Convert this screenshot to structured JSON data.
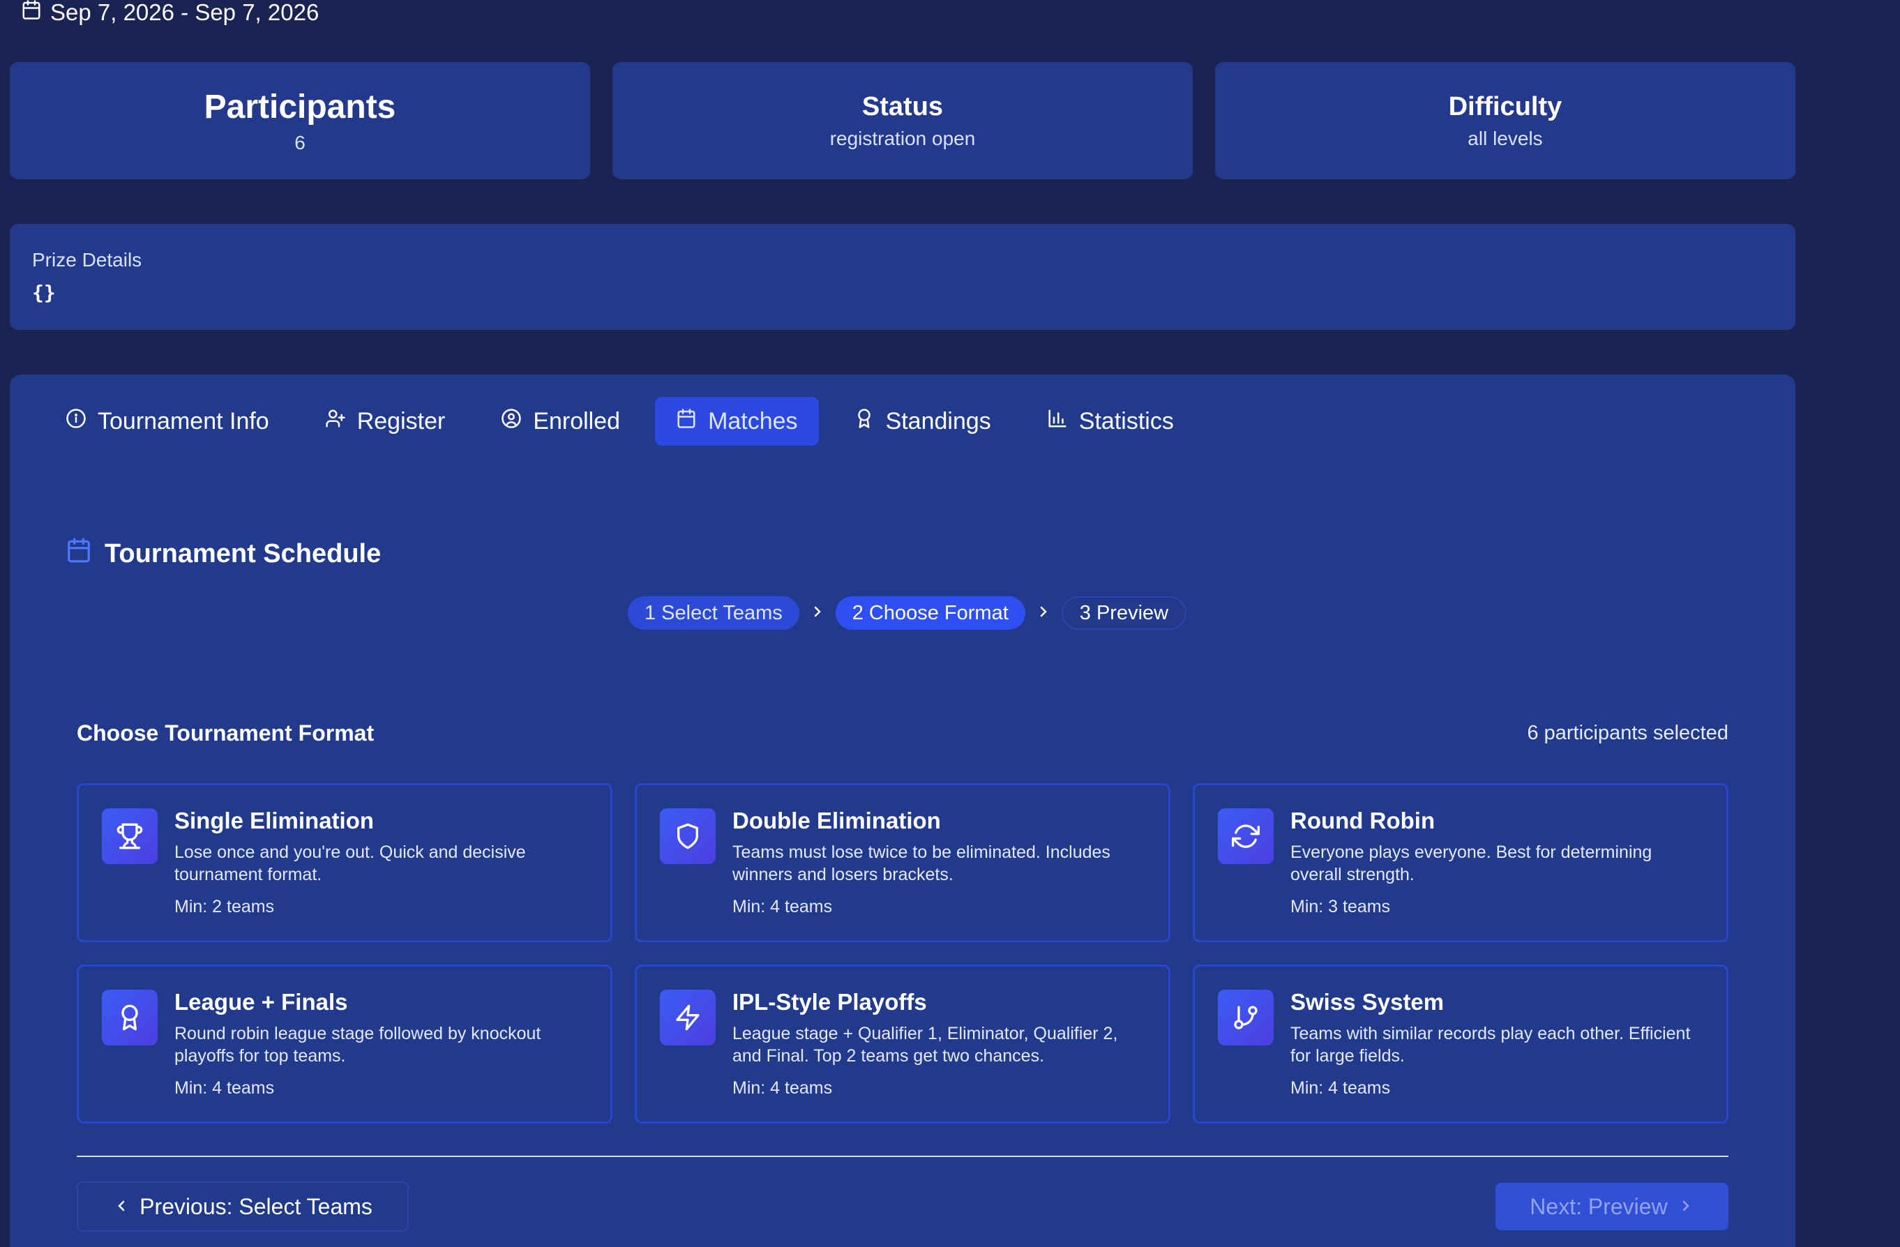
{
  "header": {
    "date_range": "Sep 7, 2026 - Sep 7, 2026"
  },
  "stats": [
    {
      "label": "Participants",
      "value": "6"
    },
    {
      "label": "Status",
      "value": "registration open"
    },
    {
      "label": "Difficulty",
      "value": "all levels"
    }
  ],
  "prize": {
    "label": "Prize Details",
    "value": "{}"
  },
  "tabs": [
    {
      "label": "Tournament Info",
      "icon": "info-icon"
    },
    {
      "label": "Register",
      "icon": "user-plus-icon"
    },
    {
      "label": "Enrolled",
      "icon": "user-circle-icon"
    },
    {
      "label": "Matches",
      "icon": "calendar-icon",
      "active": true
    },
    {
      "label": "Standings",
      "icon": "award-icon"
    },
    {
      "label": "Statistics",
      "icon": "bar-chart-icon"
    }
  ],
  "schedule": {
    "title": "Tournament Schedule",
    "steps": [
      {
        "label": "1 Select Teams",
        "state": "done"
      },
      {
        "label": "2 Choose Format",
        "state": "current"
      },
      {
        "label": "3 Preview",
        "state": "future"
      }
    ]
  },
  "format": {
    "heading": "Choose Tournament Format",
    "selected_count": "6 participants selected",
    "options": [
      {
        "title": "Single Elimination",
        "description": "Lose once and you're out. Quick and decisive tournament format.",
        "min": "Min: 2 teams",
        "icon": "trophy-icon"
      },
      {
        "title": "Double Elimination",
        "description": "Teams must lose twice to be eliminated. Includes winners and losers brackets.",
        "min": "Min: 4 teams",
        "icon": "shield-icon"
      },
      {
        "title": "Round Robin",
        "description": "Everyone plays everyone. Best for determining overall strength.",
        "min": "Min: 3 teams",
        "icon": "refresh-icon"
      },
      {
        "title": "League + Finals",
        "description": "Round robin league stage followed by knockout playoffs for top teams.",
        "min": "Min: 4 teams",
        "icon": "award-icon"
      },
      {
        "title": "IPL-Style Playoffs",
        "description": "League stage + Qualifier 1, Eliminator, Qualifier 2, and Final. Top 2 teams get two chances.",
        "min": "Min: 4 teams",
        "icon": "lightning-icon"
      },
      {
        "title": "Swiss System",
        "description": "Teams with similar records play each other. Efficient for large fields.",
        "min": "Min: 4 teams",
        "icon": "git-branch-icon"
      }
    ]
  },
  "nav": {
    "prev_label": "Previous: Select Teams",
    "next_label": "Next: Preview"
  },
  "colors": {
    "background": "#1b2352",
    "card": "#233a8c",
    "accent": "#2f50f0",
    "card_border": "#2a46c8"
  }
}
